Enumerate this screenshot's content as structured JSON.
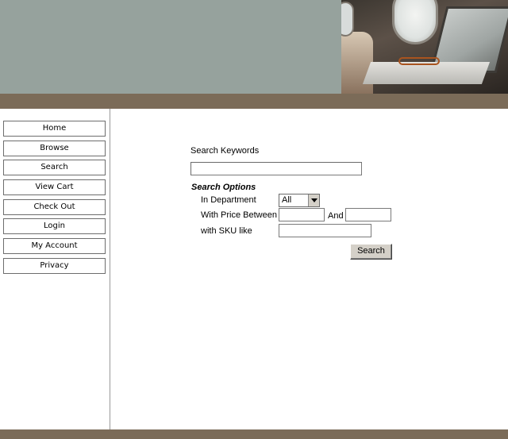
{
  "banner": {
    "image": "airplane-laptop-photo"
  },
  "nav": {
    "items": [
      {
        "label": "Home"
      },
      {
        "label": "Browse"
      },
      {
        "label": "Search"
      },
      {
        "label": "View Cart"
      },
      {
        "label": "Check Out"
      },
      {
        "label": "Login"
      },
      {
        "label": "My Account"
      },
      {
        "label": "Privacy"
      }
    ]
  },
  "search": {
    "keywords_label": "Search Keywords",
    "keywords_value": "",
    "options_heading": "Search Options",
    "department_label": "In Department",
    "department_value": "All",
    "price_label": "With Price Between",
    "price_min": "",
    "and_label": "And",
    "price_max": "",
    "sku_label": "with SKU like",
    "sku_value": "",
    "button_label": "Search"
  },
  "colors": {
    "banner_bg": "#96a29d",
    "band": "#7b6b58",
    "button_face": "#d4d0c8"
  }
}
